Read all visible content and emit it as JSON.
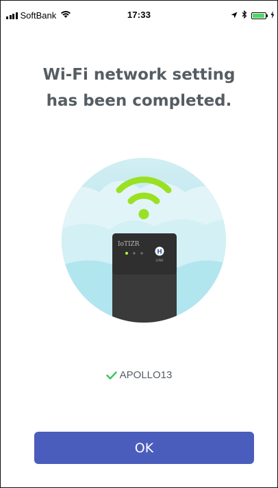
{
  "status_bar": {
    "carrier": "SoftBank",
    "time": "17:33",
    "battery_level": 0.95,
    "battery_color": "#4cd964"
  },
  "title": {
    "line1": "Wi-Fi network setting",
    "line2": "has been completed."
  },
  "illustration": {
    "device_brand": "IoTIZR",
    "device_button_letter": "H",
    "device_button_label": "LINK",
    "wifi_icon_color": "#9ae023",
    "sky_color": "#c9ecf2",
    "device_color": "#3a3a3a"
  },
  "network": {
    "icon": "checkmark-icon",
    "icon_color": "#34c759",
    "ssid": "APOLLO13"
  },
  "ok_button": {
    "label": "OK",
    "color": "#4a5dbc"
  }
}
